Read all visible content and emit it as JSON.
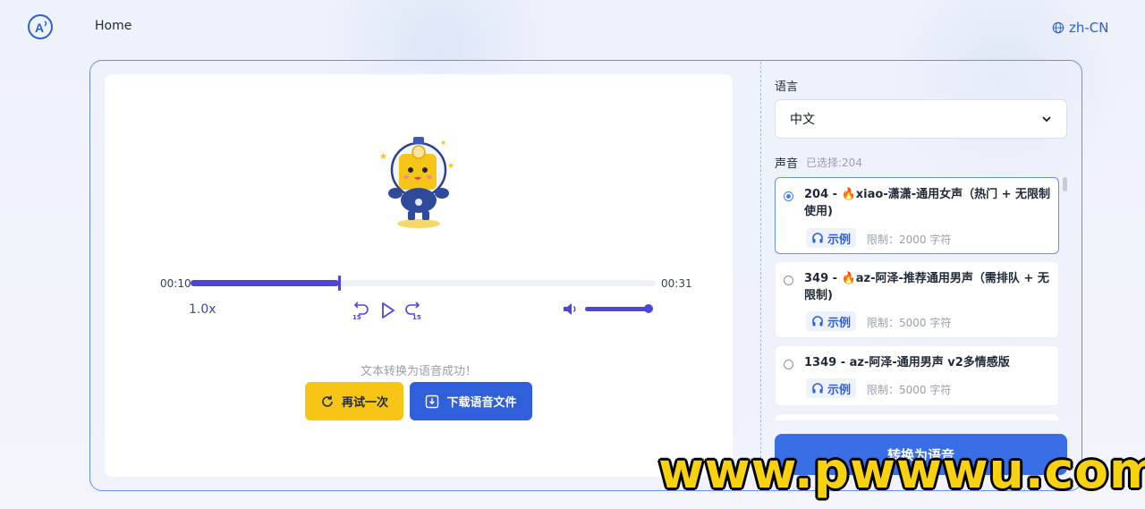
{
  "header": {
    "nav_home": "Home",
    "lang_switch": "zh-CN"
  },
  "player": {
    "current_time": "00:10",
    "total_time": "00:31",
    "progress_fraction": 0.32,
    "speed": "1.0x",
    "volume_fraction": 1.0,
    "success_message": "文本转换为语音成功！",
    "retry_label": "再试一次",
    "download_label": "下载语音文件"
  },
  "panel": {
    "language_label": "语言",
    "language_value": "中文",
    "voice_label": "声音",
    "voice_selected": "已选择:204",
    "sample_label": "示例",
    "voices": [
      {
        "title": "204 - 🔥xiao-潇潇-通用女声（热门 + 无限制使用)",
        "limit": "限制：2000 字符",
        "selected": true
      },
      {
        "title": "349 - 🔥az-阿泽-推荐通用男声（需排队 + 无限制)",
        "limit": "限制：5000 字符",
        "selected": false
      },
      {
        "title": "1349 - az-阿泽-通用男声 v2多情感版",
        "limit": "限制：5000 字符",
        "selected": false
      }
    ],
    "convert_label": "转换为语音"
  },
  "watermark": "www.pwwwu.com",
  "colors": {
    "accent": "#4f46d9",
    "primary_blue": "#2f5fd9",
    "retry_yellow": "#f7c515",
    "border_blue": "#6b8ee6"
  }
}
